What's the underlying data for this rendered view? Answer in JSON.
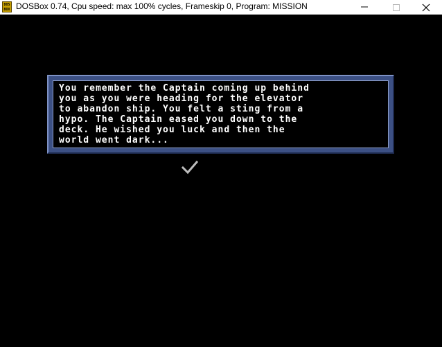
{
  "window": {
    "title": "DOSBox 0.74, Cpu speed: max 100% cycles, Frameskip  0, Program:  MISSION",
    "icon": "dosbox-icon",
    "icon_text": [
      "DOS",
      "BOX"
    ],
    "controls": [
      "minimize",
      "maximize",
      "close"
    ]
  },
  "dialog": {
    "lines": [
      "You remember the Captain coming up behind",
      "you as you were heading for the elevator",
      "to abandon ship. You felt a sting from a",
      "hypo. The Captain eased you down to the",
      "deck. He wished you luck and then the",
      "world went dark..."
    ],
    "continue_icon": "checkmark-icon"
  },
  "colors": {
    "titlebar_bg": "#ffffff",
    "screen_bg": "#000000",
    "dialog_frame": "#3c5084",
    "dialog_text": "#ffffff",
    "checkmark": "#bdbdbd"
  }
}
